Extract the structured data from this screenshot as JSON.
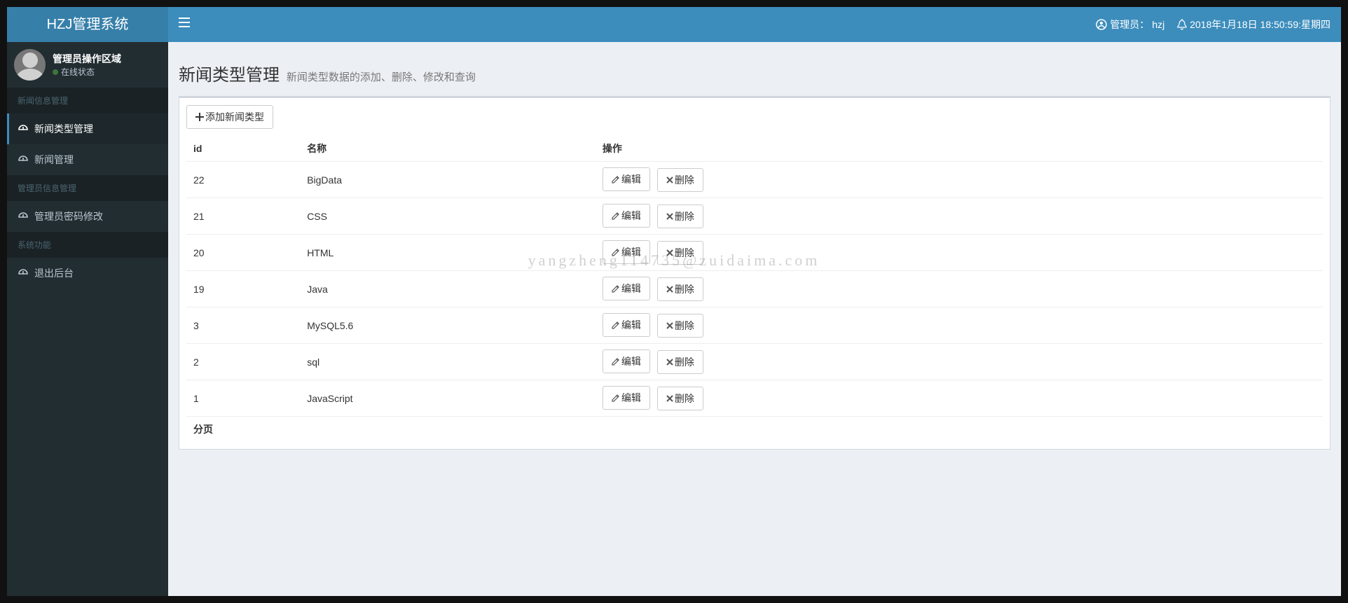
{
  "brand": "HZJ管理系统",
  "navbar": {
    "admin_label": "管理员：",
    "admin_name": "hzj",
    "datetime": "2018年1月18日 18:50:59:星期四"
  },
  "user_panel": {
    "title": "管理员操作区域",
    "status": "在线状态"
  },
  "sidebar": {
    "groups": [
      {
        "header": "新闻信息管理",
        "items": [
          {
            "label": "新闻类型管理",
            "active": true,
            "name": "sidebar-item-news-type"
          },
          {
            "label": "新闻管理",
            "active": false,
            "name": "sidebar-item-news"
          }
        ]
      },
      {
        "header": "管理员信息管理",
        "items": [
          {
            "label": "管理员密码修改",
            "active": false,
            "name": "sidebar-item-admin-password"
          }
        ]
      },
      {
        "header": "系统功能",
        "items": [
          {
            "label": "退出后台",
            "active": false,
            "name": "sidebar-item-logout"
          }
        ]
      }
    ]
  },
  "page": {
    "title": "新闻类型管理",
    "subtitle": "新闻类型数据的添加、删除、修改和查询",
    "add_button": "添加新闻类型"
  },
  "table": {
    "headers": {
      "id": "id",
      "name": "名称",
      "ops": "操作"
    },
    "edit_label": "编辑",
    "delete_label": "删除",
    "rows": [
      {
        "id": "22",
        "name": "BigData"
      },
      {
        "id": "21",
        "name": "CSS"
      },
      {
        "id": "20",
        "name": "HTML"
      },
      {
        "id": "19",
        "name": "Java"
      },
      {
        "id": "3",
        "name": "MySQL5.6"
      },
      {
        "id": "2",
        "name": "sql"
      },
      {
        "id": "1",
        "name": "JavaScript"
      }
    ],
    "pager_label": "分页"
  },
  "watermark": "yangzheng114735@zuidaima.com"
}
